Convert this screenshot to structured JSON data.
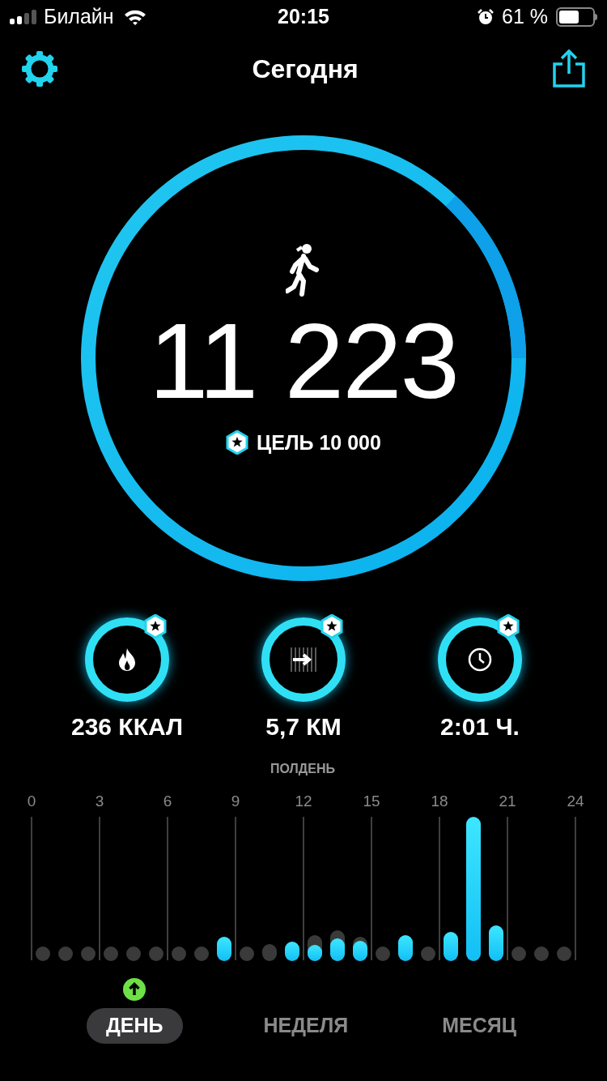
{
  "status_bar": {
    "carrier": "Билайн",
    "time": "20:15",
    "battery_text": "61 %"
  },
  "header": {
    "title": "Сегодня"
  },
  "steps": {
    "count": "11 223",
    "goal": "ЦЕЛЬ 10 000"
  },
  "metrics": [
    {
      "kind": "calories",
      "value": "236 ККАЛ"
    },
    {
      "kind": "distance",
      "value": "5,7 КМ"
    },
    {
      "kind": "time",
      "value": "2:01 Ч."
    }
  ],
  "chart": {
    "caption": "ПОЛДЕНЬ",
    "hour_labels": [
      "0",
      "3",
      "6",
      "9",
      "12",
      "15",
      "18",
      "21",
      "24"
    ]
  },
  "tabs": [
    {
      "label": "ДЕНЬ",
      "selected": true
    },
    {
      "label": "НЕДЕЛЯ",
      "selected": false
    },
    {
      "label": "МЕСЯЦ",
      "selected": false
    }
  ]
}
